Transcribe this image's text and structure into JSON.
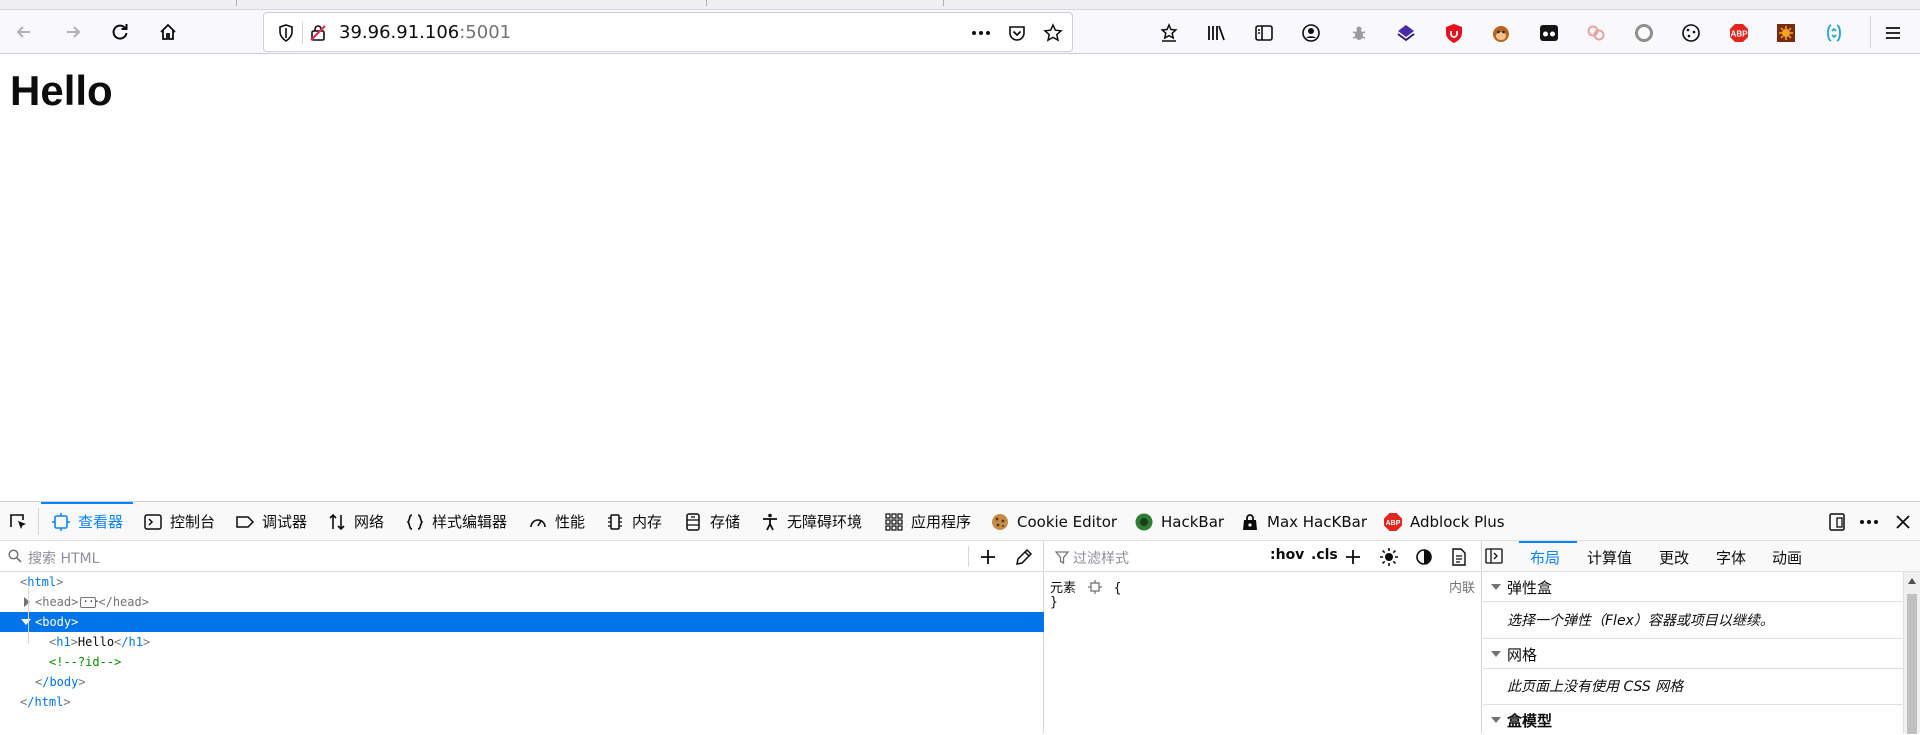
{
  "browser": {
    "url_host": "39.96.91.106",
    "url_port": ":5001",
    "page_actions": [
      "more-actions-icon",
      "pocket-icon",
      "bookmark-star-icon"
    ],
    "extensions": [
      "bookmarks-menu-icon",
      "library-icon",
      "sidebar-icon",
      "account-icon",
      "bug-icon",
      "layers-icon",
      "ublock-icon",
      "tampermonkey-icon",
      "dark-reader-icon",
      "link-icon",
      "circle-icon",
      "cookie-icon",
      "abp-icon",
      "sun-icon",
      "swap-icon"
    ],
    "extension_abp_text": "ABP"
  },
  "page": {
    "heading": "Hello"
  },
  "devtools": {
    "tabs": [
      {
        "label": "查看器",
        "icon": "inspector-icon"
      },
      {
        "label": "控制台",
        "icon": "console-icon"
      },
      {
        "label": "调试器",
        "icon": "debugger-icon"
      },
      {
        "label": "网络",
        "icon": "network-icon"
      },
      {
        "label": "样式编辑器",
        "icon": "style-editor-icon"
      },
      {
        "label": "性能",
        "icon": "performance-icon"
      },
      {
        "label": "内存",
        "icon": "memory-icon"
      },
      {
        "label": "存储",
        "icon": "storage-icon"
      },
      {
        "label": "无障碍环境",
        "icon": "accessibility-icon"
      },
      {
        "label": "应用程序",
        "icon": "application-icon"
      },
      {
        "label": "Cookie Editor",
        "icon": "cookie-editor-icon"
      },
      {
        "label": "HackBar",
        "icon": "hackbar-icon"
      },
      {
        "label": "Max HacKBar",
        "icon": "max-hackbar-icon"
      },
      {
        "label": "Adblock Plus",
        "icon": "adblock-plus-icon"
      }
    ],
    "markup": {
      "search_placeholder": "搜索 HTML",
      "lines": {
        "html_open": "html",
        "head": "head",
        "head_close": "/head",
        "body_open": "body",
        "h1_tag": "h1",
        "h1_text": "Hello",
        "h1_close": "/h1",
        "comment": "<!--?id-->",
        "body_close": "/body",
        "html_close": "/html"
      }
    },
    "rules": {
      "filter_placeholder": "过滤样式",
      "hov": ":hov",
      "cls": ".cls",
      "element_selector": "元素",
      "brace_open": "{",
      "brace_close": "}",
      "inline_label": "内联"
    },
    "layout": {
      "tabs": [
        "布局",
        "计算值",
        "更改",
        "字体",
        "动画"
      ],
      "flexbox_header": "弹性盒",
      "flexbox_msg": "选择一个弹性（Flex）容器或项目以继续。",
      "grid_header": "网格",
      "grid_msg": "此页面上没有使用 CSS 网格",
      "boxmodel_header": "盒模型"
    }
  },
  "colors": {
    "accent": "#0a84ff",
    "selected_row": "#0074e8",
    "comment": "#058b00"
  }
}
